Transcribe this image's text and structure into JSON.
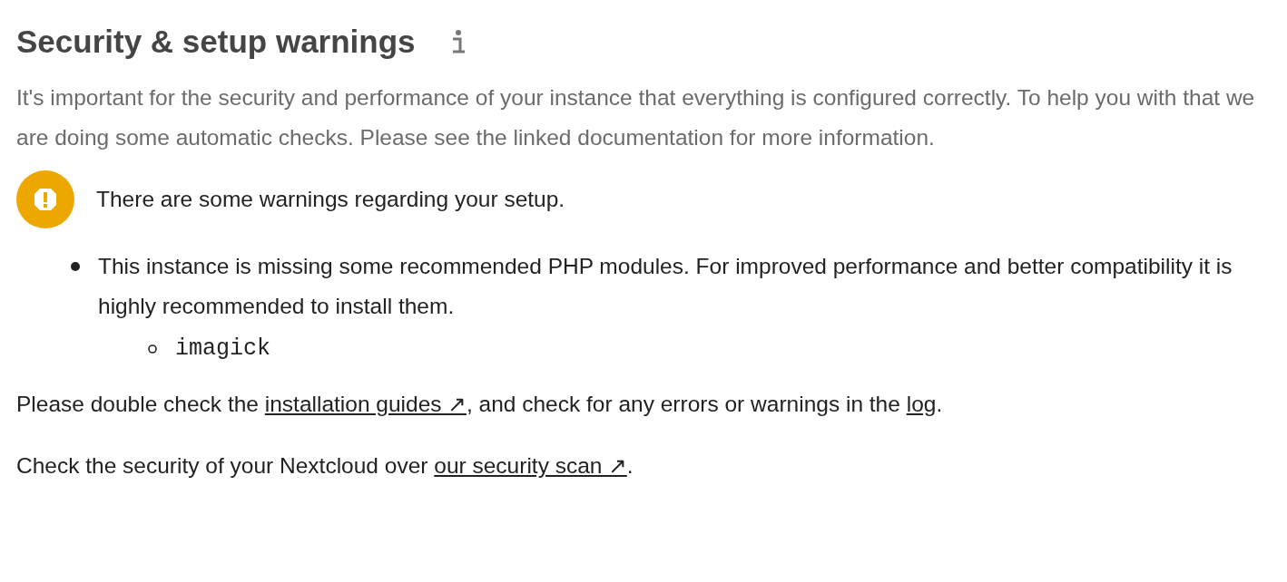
{
  "heading": "Security & setup warnings",
  "intro": "It's important for the security and performance of your instance that everything is configured correctly. To help you with that we are doing some automatic checks. Please see the linked documentation for more information.",
  "status": {
    "kind": "warning",
    "text": "There are some warnings regarding your setup."
  },
  "warnings": [
    {
      "text": "This instance is missing some recommended PHP modules. For improved performance and better compatibility it is highly recommended to install them.",
      "items": [
        "imagick"
      ]
    }
  ],
  "paragraphs": [
    [
      {
        "kind": "text",
        "text": "Please double check the "
      },
      {
        "kind": "link",
        "text": "installation guides ↗"
      },
      {
        "kind": "text",
        "text": ", and check for any errors or warnings in the "
      },
      {
        "kind": "link",
        "text": "log"
      },
      {
        "kind": "text",
        "text": "."
      }
    ],
    [
      {
        "kind": "text",
        "text": "Check the security of your Nextcloud over "
      },
      {
        "kind": "link",
        "text": "our security scan ↗"
      },
      {
        "kind": "text",
        "text": "."
      }
    ]
  ]
}
